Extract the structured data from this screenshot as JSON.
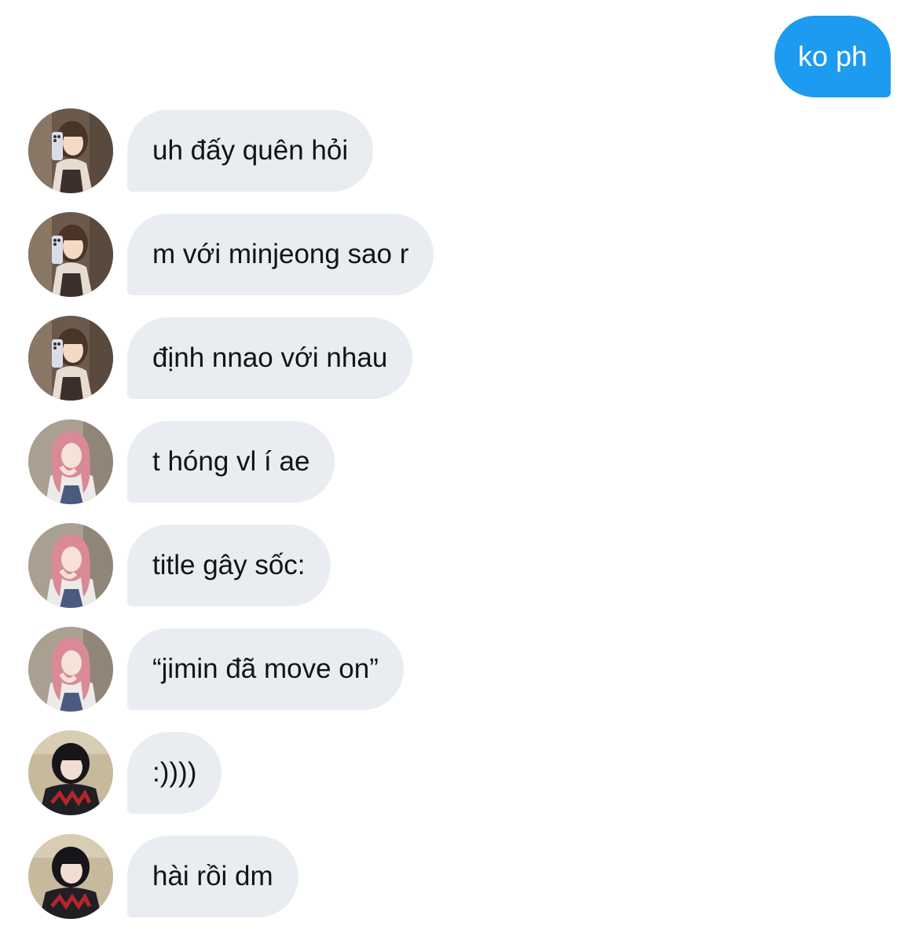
{
  "sent_messages": [
    {
      "text": "ko ph",
      "color": "#1d9bf0"
    }
  ],
  "received_messages": [
    {
      "text": "uh đấy quên hỏi",
      "avatar": "avatar-brown-hair-phone-selfie"
    },
    {
      "text": "m với minjeong sao r",
      "avatar": "avatar-brown-hair-phone-selfie"
    },
    {
      "text": "định nnao với nhau",
      "avatar": "avatar-brown-hair-phone-selfie"
    },
    {
      "text": "t hóng vl í ae",
      "avatar": "avatar-pink-hair-pose"
    },
    {
      "text": "title gây sốc:",
      "avatar": "avatar-pink-hair-pose"
    },
    {
      "text": "“jimin đã move on”",
      "avatar": "avatar-pink-hair-pose"
    },
    {
      "text": ":))))",
      "avatar": "avatar-black-bob-hair"
    },
    {
      "text": "hài rồi dm",
      "avatar": "avatar-black-bob-hair"
    }
  ],
  "colors": {
    "sent_bubble": "#1d9bf0",
    "received_bubble": "#e9edf1",
    "received_text": "#0f1419",
    "background": "#ffffff"
  }
}
